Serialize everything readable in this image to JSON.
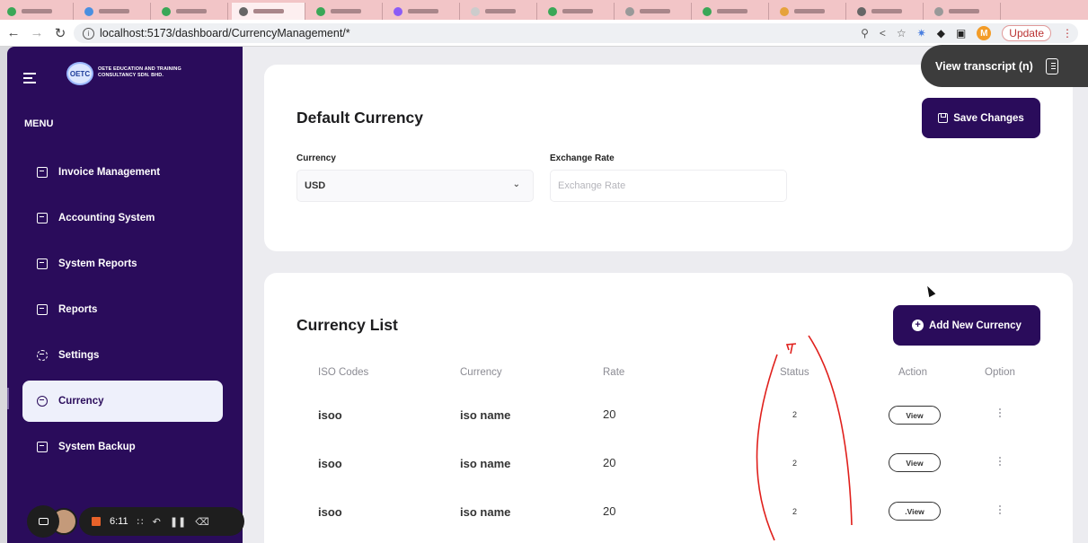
{
  "browser": {
    "url": "localhost:5173/dashboard/CurrencyManagement/*",
    "update_label": "Update",
    "profile_initial": "M"
  },
  "sidebar": {
    "logo_text": "OETC",
    "company_name": "OETE EDUCATION AND TRAINING CONSULTANCY SDN. BHD.",
    "menu_label": "MENU",
    "items": [
      {
        "label": "Invoice Management",
        "icon": "invoice-icon"
      },
      {
        "label": "Accounting System",
        "icon": "accounting-icon"
      },
      {
        "label": "System Reports",
        "icon": "chart-icon"
      },
      {
        "label": "Reports",
        "icon": "report-icon"
      },
      {
        "label": "Settings",
        "icon": "gear-icon"
      },
      {
        "label": "Currency",
        "icon": "globe-icon",
        "active": true
      },
      {
        "label": "System Backup",
        "icon": "backup-icon"
      }
    ]
  },
  "default_currency": {
    "title": "Default Currency",
    "save_label": "Save Changes",
    "currency_label": "Currency",
    "currency_value": "USD",
    "rate_label": "Exchange Rate",
    "rate_placeholder": "Exchange Rate"
  },
  "currency_list": {
    "title": "Currency List",
    "add_label": "Add New Currency",
    "columns": [
      "ISO Codes",
      "Currency",
      "Rate",
      "Status",
      "Action",
      "Option"
    ],
    "rows": [
      {
        "iso": "isoo",
        "currency": "iso name",
        "rate": "20",
        "status": "2",
        "action": "View"
      },
      {
        "iso": "isoo",
        "currency": "iso name",
        "rate": "20",
        "status": "2",
        "action": "View"
      },
      {
        "iso": "isoo",
        "currency": "iso name",
        "rate": "20",
        "status": "2",
        "action": ".View"
      }
    ]
  },
  "overlays": {
    "transcript_label": "View transcript (n)",
    "recorder_time": "6:11"
  },
  "colors": {
    "primary": "#2a0c5b",
    "background": "#ececf0",
    "annotation": "#e0201c"
  }
}
